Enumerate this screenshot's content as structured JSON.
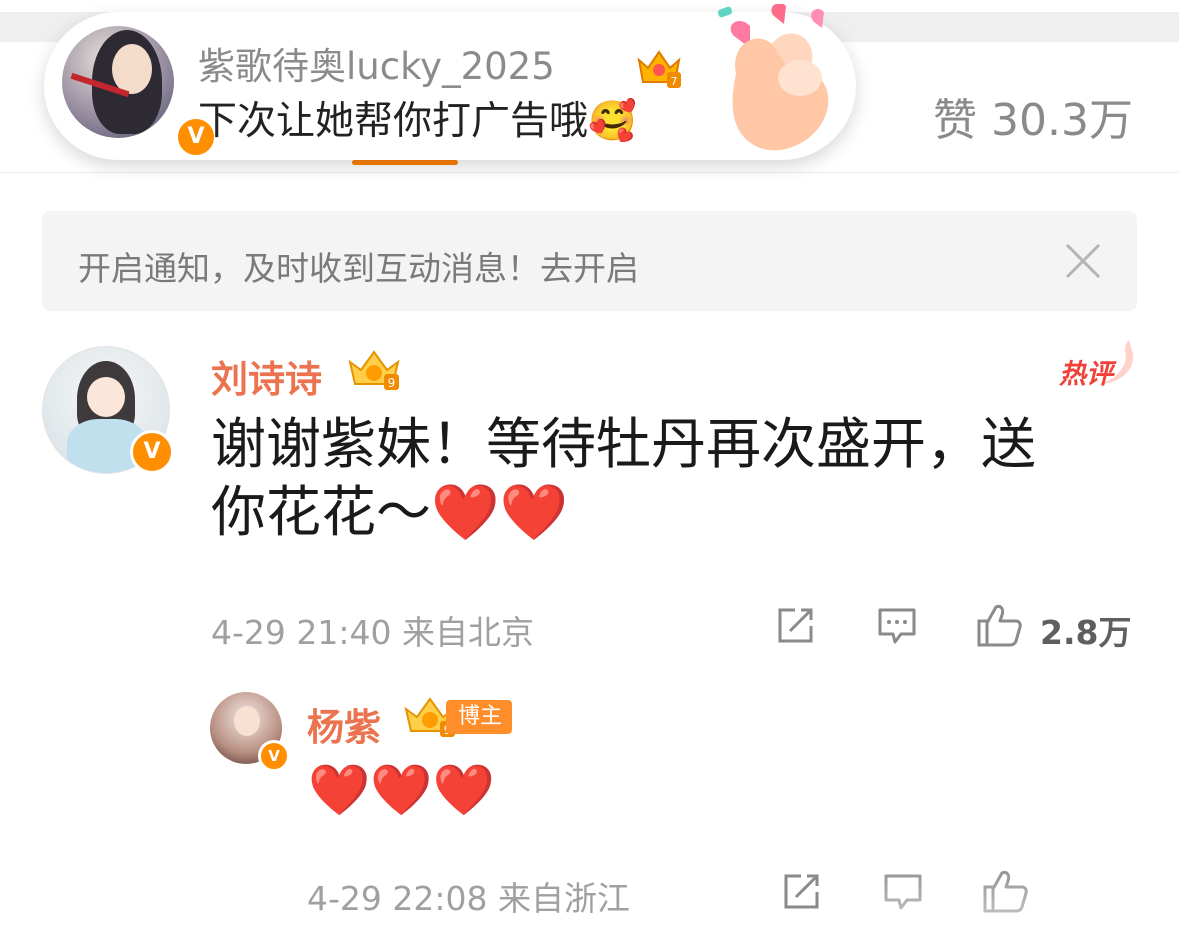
{
  "header": {
    "likes_label": "赞 30.3万"
  },
  "toast": {
    "username": "紫歌待奥lucky_2025",
    "message": "下次让她帮你打广告哦",
    "message_emoji": "🥰",
    "crown_level": "7"
  },
  "notice": {
    "text": "开启通知，及时收到互动消息！去开启"
  },
  "comment": {
    "author": "刘诗诗",
    "crown_level": "9",
    "hot_tag": "热评",
    "text": "谢谢紫妹！等待牡丹再次盛开，送你花花～❤️❤️",
    "time_location": "4-29 21:40 来自北京",
    "like_count": "2.8万"
  },
  "reply": {
    "author": "杨紫",
    "crown_level": "9",
    "tag": "博主",
    "text": "❤️❤️❤️",
    "time_location": "4-29 22:08 来自浙江"
  },
  "colors": {
    "accent_orange": "#ff8200",
    "name_orange": "#eb7350",
    "hot_red": "#f0423a",
    "muted_text": "#a0a0a0"
  }
}
